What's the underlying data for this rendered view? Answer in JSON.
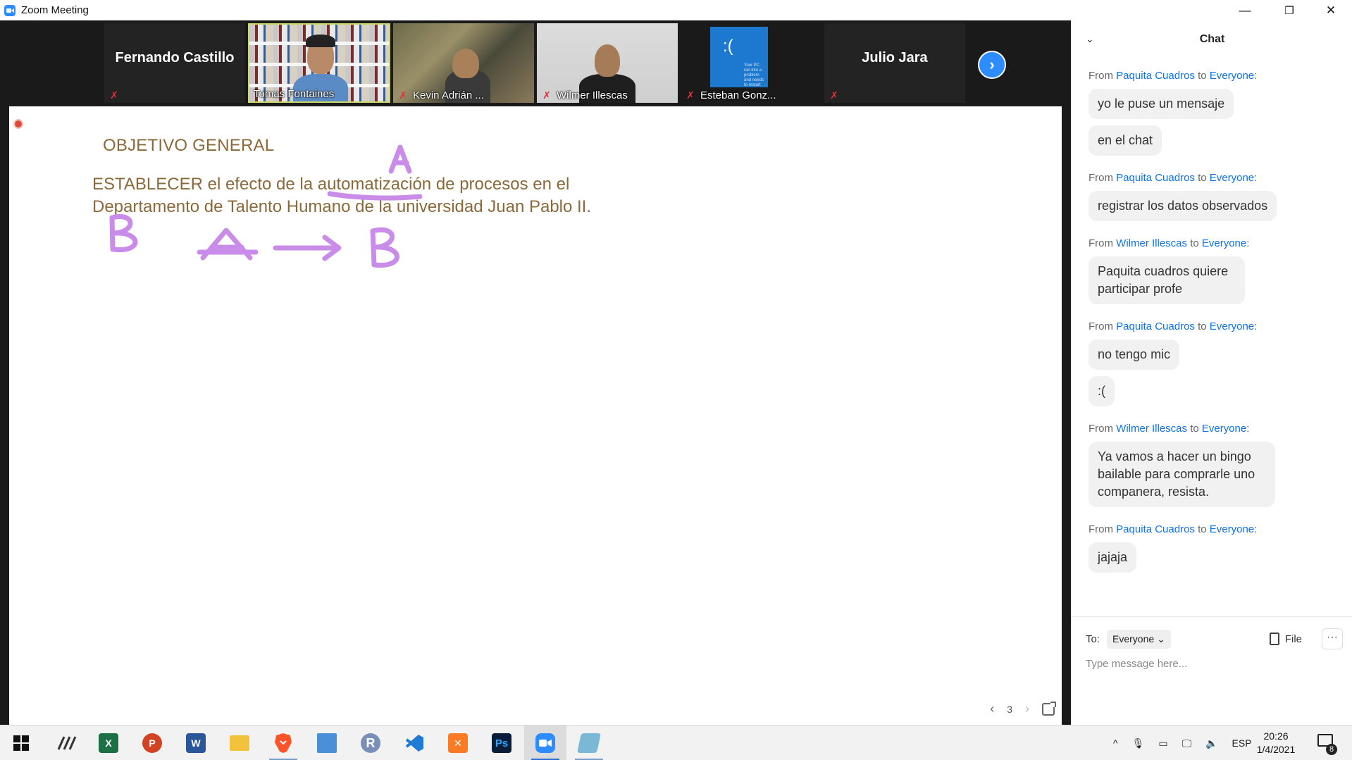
{
  "window": {
    "title": "Zoom Meeting",
    "controls": {
      "minimize": "—",
      "restore": "❐",
      "close": "✕"
    }
  },
  "video_strip": {
    "participants": [
      {
        "name": "Fernando Castillo",
        "video_on": false,
        "muted": true
      },
      {
        "name": "Tomas Fontaines",
        "video_on": true,
        "muted": false,
        "active_speaker": true
      },
      {
        "name": "Kevin Adrián ...",
        "video_on": true,
        "muted": true
      },
      {
        "name": "Wilmer Illescas",
        "video_on": true,
        "muted": true
      },
      {
        "name": "Esteban Gonz...",
        "video_on": true,
        "muted": true
      },
      {
        "name": "Julio Jara",
        "video_on": false,
        "muted": true
      }
    ],
    "bsod_face": ":(",
    "bsod_text": "Your PC ran into a problem and needs to restart",
    "next_button": "›",
    "mute_icon": "✗"
  },
  "whiteboard": {
    "heading": "OBJETIVO GENERAL",
    "body_line1_pre": "ESTABLECER el efecto de la ",
    "body_line1_emph": "automatización",
    "body_line1_post": " de procesos en el",
    "body_line2": "Departamento de Talento Humano de la universidad Juan Pablo II.",
    "ink_color": "#c98ce8",
    "text_color": "#8a6a3a",
    "annotations": {
      "letter_over_word": "A",
      "letter_left": "B",
      "formula_left": "A",
      "formula_right": "B"
    },
    "page_nav": {
      "prev": "‹",
      "page": "3",
      "next": "›"
    }
  },
  "chat": {
    "title": "Chat",
    "collapse_icon": "⌄",
    "messages": [
      {
        "from": "Paquita Cuadros",
        "to": "Everyone",
        "texts": [
          "yo le puse un mensaje",
          "en el chat"
        ]
      },
      {
        "from": "Paquita Cuadros",
        "to": "Everyone",
        "texts": [
          "registrar los datos observados"
        ]
      },
      {
        "from": "Wilmer Illescas",
        "to": "Everyone",
        "texts": [
          "Paquita cuadros quiere participar profe"
        ]
      },
      {
        "from": "Paquita Cuadros",
        "to": "Everyone",
        "texts": [
          "no tengo mic",
          ":("
        ]
      },
      {
        "from": "Wilmer Illescas",
        "to": "Everyone",
        "texts": [
          "Ya vamos a hacer un bingo bailable para comprarle uno companera, resista."
        ]
      },
      {
        "from": "Paquita Cuadros",
        "to": "Everyone",
        "texts": [
          "jajaja"
        ]
      }
    ],
    "labels": {
      "from": "From",
      "to_word": "to",
      "colon": ":"
    },
    "footer": {
      "to_label": "To:",
      "recipient": "Everyone",
      "file_label": "File",
      "more": "···",
      "placeholder": "Type message here..."
    }
  },
  "taskbar": {
    "apps": [
      {
        "name": "start",
        "running": false
      },
      {
        "name": "stylus-app",
        "running": false
      },
      {
        "name": "excel",
        "label": "X",
        "color": "#1d7044",
        "running": false
      },
      {
        "name": "powerpoint",
        "label": "P",
        "color": "#d04423",
        "running": false
      },
      {
        "name": "word",
        "label": "W",
        "color": "#2b579a",
        "running": false
      },
      {
        "name": "file-explorer",
        "color": "#f3c23d",
        "running": false
      },
      {
        "name": "brave",
        "color": "#fb542b",
        "running": true
      },
      {
        "name": "control-panel",
        "color": "#4a90d9",
        "running": false
      },
      {
        "name": "r-language",
        "label": "R",
        "color": "#7a8fb8",
        "running": false
      },
      {
        "name": "vscode",
        "color": "#1f7bd4",
        "running": false
      },
      {
        "name": "xampp",
        "color": "#fb7a24",
        "running": false
      },
      {
        "name": "photoshop",
        "label": "Ps",
        "color": "#0a1e3a",
        "running": false
      },
      {
        "name": "zoom",
        "color": "#2D8CFF",
        "running": true,
        "active": true
      },
      {
        "name": "notepad",
        "color": "#7ab8d6",
        "running": true
      }
    ],
    "tray": {
      "chevron": "^",
      "language": "ESP",
      "time": "20:26",
      "date": "1/4/2021",
      "notifications": "8"
    }
  }
}
